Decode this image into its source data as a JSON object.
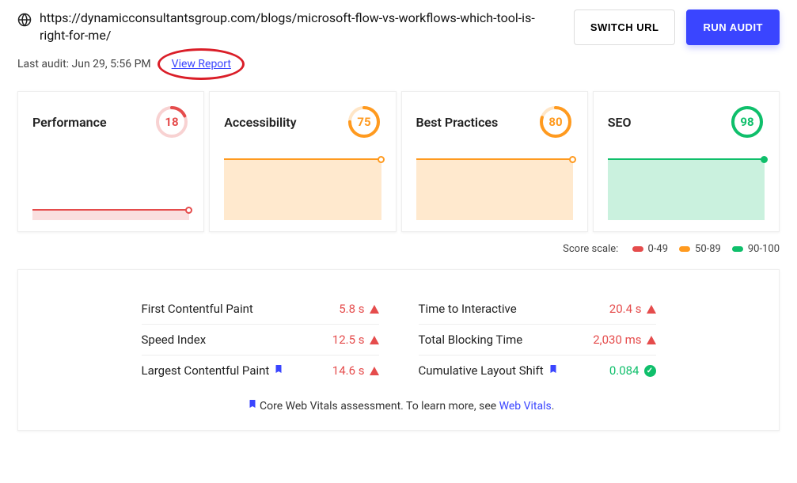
{
  "header": {
    "url": "https://dynamicconsultantsgroup.com/blogs/microsoft-flow-vs-workflows-which-tool-is-right-for-me/",
    "switch_url_label": "SWITCH URL",
    "run_audit_label": "RUN AUDIT"
  },
  "subheader": {
    "last_audit": "Last audit: Jun 29, 5:56 PM",
    "view_report_label": "View Report"
  },
  "cards": [
    {
      "title": "Performance",
      "score": "18",
      "color": "#e54c4c",
      "spark_class": "red low",
      "pct": 18
    },
    {
      "title": "Accessibility",
      "score": "75",
      "color": "#ff9a1f",
      "spark_class": "orange tall",
      "pct": 75
    },
    {
      "title": "Best Practices",
      "score": "80",
      "color": "#ff9a1f",
      "spark_class": "orange tall",
      "pct": 80
    },
    {
      "title": "SEO",
      "score": "98",
      "color": "#0fbf6b",
      "spark_class": "green tall",
      "pct": 98
    }
  ],
  "legend": {
    "label": "Score scale:",
    "ranges": [
      {
        "text": "0-49",
        "color": "#e54c4c"
      },
      {
        "text": "50-89",
        "color": "#ff9a1f"
      },
      {
        "text": "90-100",
        "color": "#0fbf6b"
      }
    ]
  },
  "metrics": {
    "left": [
      {
        "label": "First Contentful Paint",
        "value": "5.8 s",
        "status": "fail",
        "bookmark": false
      },
      {
        "label": "Speed Index",
        "value": "12.5 s",
        "status": "fail",
        "bookmark": false
      },
      {
        "label": "Largest Contentful Paint",
        "value": "14.6 s",
        "status": "fail",
        "bookmark": true
      }
    ],
    "right": [
      {
        "label": "Time to Interactive",
        "value": "20.4 s",
        "status": "fail",
        "bookmark": false
      },
      {
        "label": "Total Blocking Time",
        "value": "2,030 ms",
        "status": "fail",
        "bookmark": false
      },
      {
        "label": "Cumulative Layout Shift",
        "value": "0.084",
        "status": "pass",
        "bookmark": true
      }
    ]
  },
  "footer": {
    "text": "Core Web Vitals assessment. To learn more, see ",
    "link_text": "Web Vitals",
    "suffix": "."
  }
}
